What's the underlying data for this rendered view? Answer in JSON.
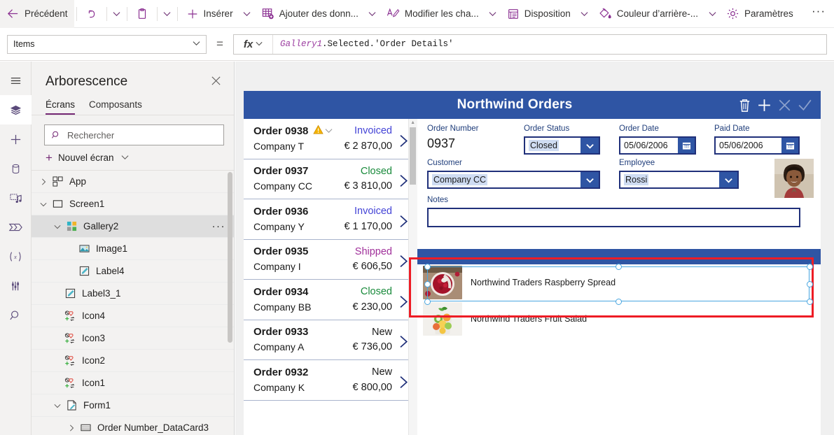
{
  "commandbar": {
    "back_label": "Précédent",
    "insert_label": "Insérer",
    "add_data_label": "Ajouter des donn...",
    "edit_fields_label": "Modifier les cha...",
    "layout_label": "Disposition",
    "background_color_label": "Couleur d’arrière-...",
    "settings_label": "Paramètres",
    "overflow_label": "···"
  },
  "formula_bar": {
    "property": "Items",
    "equals": "=",
    "fx_label": "fx",
    "formula_ident": "Gallery1",
    "formula_rest": ".Selected.'Order Details'"
  },
  "rail": {
    "items": [
      {
        "icon": "hamburger-icon"
      },
      {
        "icon": "layers-icon"
      },
      {
        "icon": "plus-insert-icon"
      },
      {
        "icon": "database-icon"
      },
      {
        "icon": "media-icon"
      },
      {
        "icon": "power-automate-icon"
      },
      {
        "icon": "variables-icon"
      },
      {
        "icon": "tools-icon"
      },
      {
        "icon": "search-icon"
      }
    ]
  },
  "tree": {
    "title": "Arborescence",
    "close_label": "✕",
    "tabs": [
      {
        "label": "Écrans",
        "selected": true
      },
      {
        "label": "Composants",
        "selected": false
      }
    ],
    "search_placeholder": "Rechercher",
    "new_screen_label": "Nouvel écran",
    "nodes": [
      {
        "label": "App",
        "indent": 0,
        "twisty": "collapsed",
        "icon": "app-icon",
        "selected": false,
        "dots": false
      },
      {
        "label": "Screen1",
        "indent": 0,
        "twisty": "expanded",
        "icon": "screen-icon",
        "selected": false,
        "dots": false
      },
      {
        "label": "Gallery2",
        "indent": 1,
        "twisty": "expanded",
        "icon": "gallery-icon",
        "selected": true,
        "dots": true
      },
      {
        "label": "Image1",
        "indent": 2,
        "twisty": "none",
        "icon": "image-icon",
        "selected": false,
        "dots": false
      },
      {
        "label": "Label4",
        "indent": 2,
        "twisty": "none",
        "icon": "label-icon",
        "selected": false,
        "dots": false
      },
      {
        "label": "Label3_1",
        "indent": 1,
        "twisty": "none",
        "icon": "label-icon",
        "selected": false,
        "dots": false
      },
      {
        "label": "Icon4",
        "indent": 1,
        "twisty": "none",
        "icon": "icon-control-icon",
        "selected": false,
        "dots": false
      },
      {
        "label": "Icon3",
        "indent": 1,
        "twisty": "none",
        "icon": "icon-control-icon",
        "selected": false,
        "dots": false
      },
      {
        "label": "Icon2",
        "indent": 1,
        "twisty": "none",
        "icon": "icon-control-icon",
        "selected": false,
        "dots": false
      },
      {
        "label": "Icon1",
        "indent": 1,
        "twisty": "none",
        "icon": "icon-control-icon",
        "selected": false,
        "dots": false
      },
      {
        "label": "Form1",
        "indent": 1,
        "twisty": "expanded",
        "icon": "form-icon",
        "selected": false,
        "dots": false
      },
      {
        "label": "Order Number_DataCard3",
        "indent": 2,
        "twisty": "collapsed",
        "icon": "datacard-icon",
        "selected": false,
        "dots": false
      }
    ]
  },
  "app": {
    "title": "Northwind Orders",
    "actions": [
      {
        "name": "delete-icon",
        "dim": false
      },
      {
        "name": "add-icon",
        "dim": false
      },
      {
        "name": "cancel-icon",
        "dim": true
      },
      {
        "name": "save-icon",
        "dim": true
      }
    ],
    "orders": [
      {
        "number": "Order 0938",
        "company": "Company T",
        "status": "Invoiced",
        "status_color": "#4343d6",
        "amount": "€ 2 870,00",
        "warning": true
      },
      {
        "number": "Order 0937",
        "company": "Company CC",
        "status": "Closed",
        "status_color": "#198a3b",
        "amount": "€ 3 810,00",
        "warning": false
      },
      {
        "number": "Order 0936",
        "company": "Company Y",
        "status": "Invoiced",
        "status_color": "#4343d6",
        "amount": "€ 1 170,00",
        "warning": false
      },
      {
        "number": "Order 0935",
        "company": "Company I",
        "status": "Shipped",
        "status_color": "#a0309a",
        "amount": "€  606,50",
        "warning": false
      },
      {
        "number": "Order 0934",
        "company": "Company BB",
        "status": "Closed",
        "status_color": "#198a3b",
        "amount": "€  230,00",
        "warning": false
      },
      {
        "number": "Order 0933",
        "company": "Company A",
        "status": "New",
        "status_color": "#1a1a1a",
        "amount": "€  736,00",
        "warning": false
      },
      {
        "number": "Order 0932",
        "company": "Company K",
        "status": "New",
        "status_color": "#1a1a1a",
        "amount": "€  800,00",
        "warning": false
      }
    ],
    "form": {
      "order_number_label": "Order Number",
      "order_number_value": "0937",
      "order_status_label": "Order Status",
      "order_status_value": "Closed",
      "order_date_label": "Order Date",
      "order_date_value": "05/06/2006",
      "paid_date_label": "Paid Date",
      "paid_date_value": "05/06/2006",
      "customer_label": "Customer",
      "customer_value": "Company CC",
      "employee_label": "Employee",
      "employee_value": "Rossi",
      "notes_label": "Notes",
      "notes_value": ""
    },
    "products": [
      {
        "name": "Northwind Traders Raspberry Spread",
        "selected": true
      },
      {
        "name": "Northwind Traders Fruit Salad",
        "selected": false
      }
    ]
  },
  "colors": {
    "brand_purple": "#742774",
    "app_header_blue": "#2f55a4",
    "selection_red": "#ee1c25",
    "selection_blue": "#49a6e0",
    "status_invoiced": "#4343d6",
    "status_closed": "#198a3b",
    "status_shipped": "#a0309a",
    "status_new": "#1a1a1a"
  }
}
